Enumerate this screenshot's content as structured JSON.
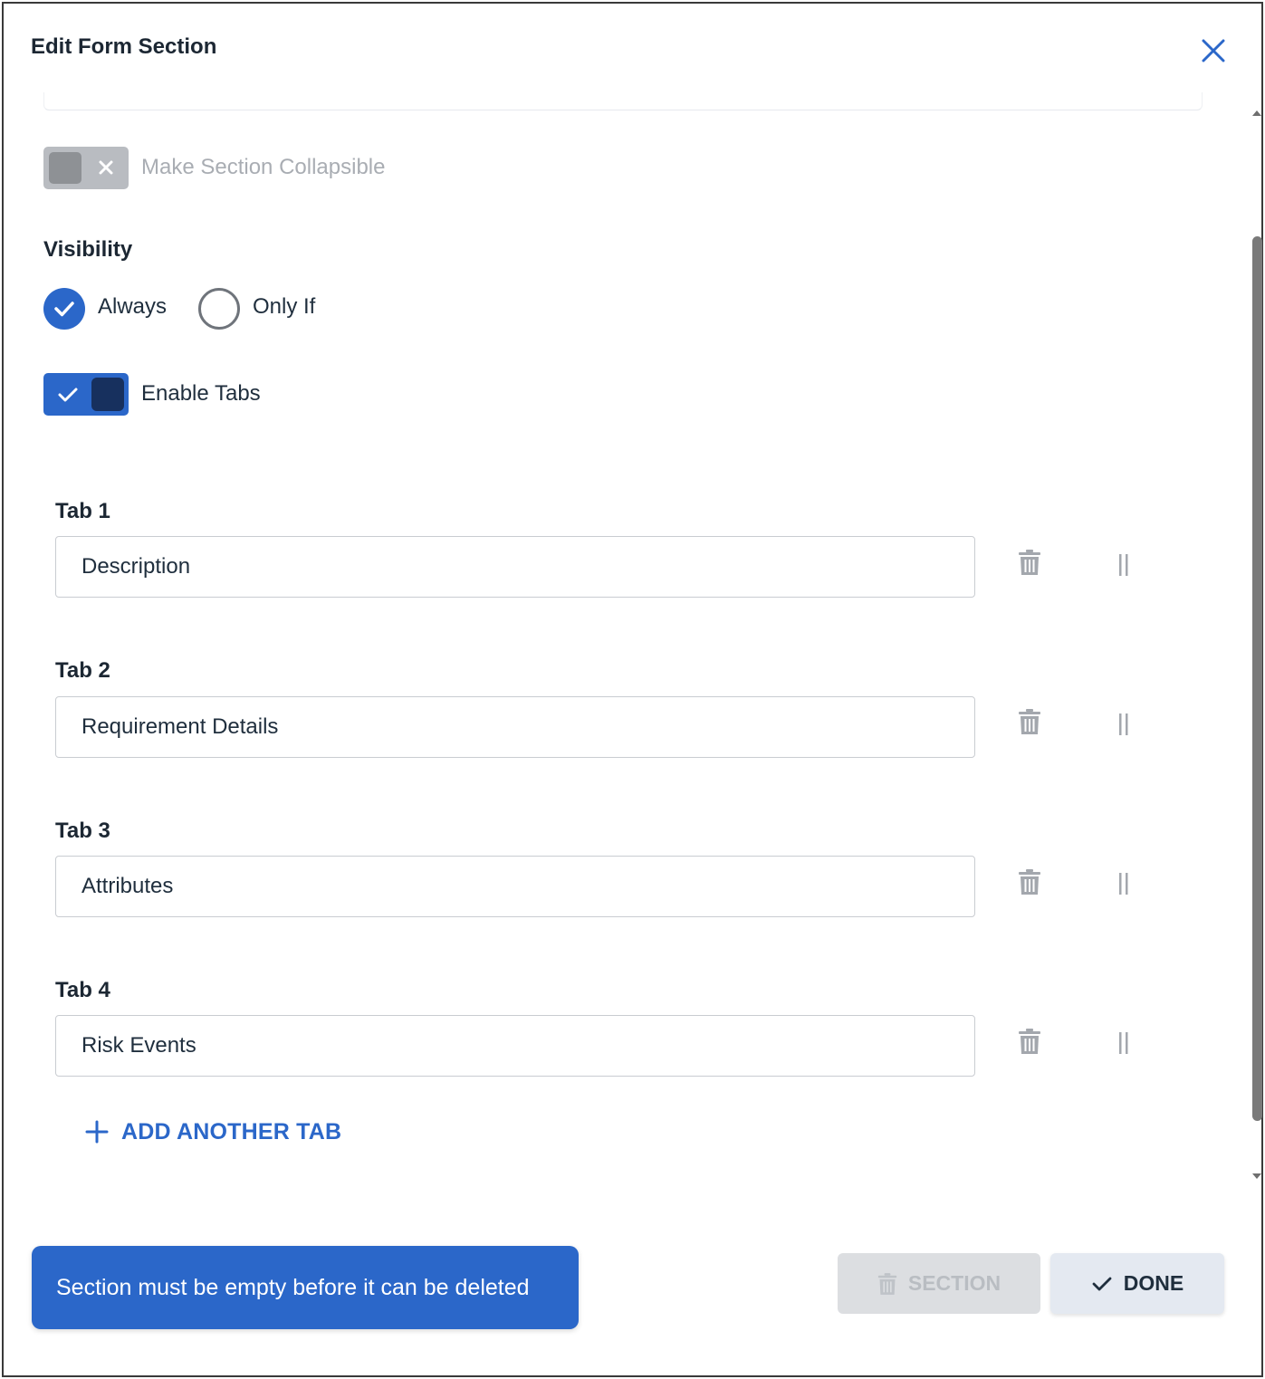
{
  "dialog": {
    "title": "Edit Form Section",
    "close_icon": "close-icon"
  },
  "collapsible": {
    "label": "Make Section Collapsible",
    "enabled": false
  },
  "visibility": {
    "heading": "Visibility",
    "options": [
      {
        "label": "Always",
        "selected": true
      },
      {
        "label": "Only If",
        "selected": false
      }
    ]
  },
  "enable_tabs": {
    "label": "Enable Tabs",
    "enabled": true
  },
  "tabs": [
    {
      "label": "Tab 1",
      "value": "Description"
    },
    {
      "label": "Tab 2",
      "value": "Requirement Details"
    },
    {
      "label": "Tab 3",
      "value": "Attributes"
    },
    {
      "label": "Tab 4",
      "value": "Risk Events"
    }
  ],
  "add_tab": {
    "label": "ADD ANOTHER TAB"
  },
  "toast": {
    "message": "Section must be empty before it can be deleted"
  },
  "footer": {
    "delete_section_label": "SECTION",
    "done_label": "DONE"
  },
  "colors": {
    "accent": "#2b67c9",
    "toggle_off": "#b9bcc1",
    "knob_on": "#17305e"
  }
}
